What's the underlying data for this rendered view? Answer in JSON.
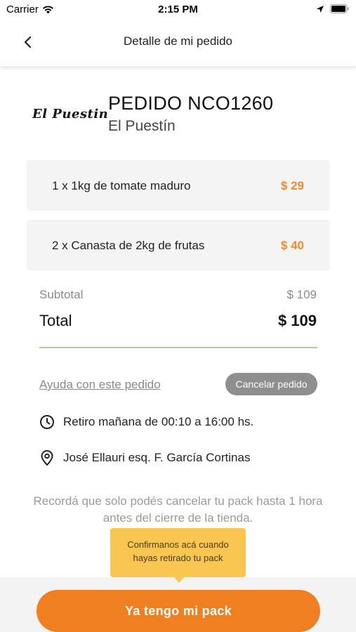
{
  "status_bar": {
    "carrier": "Carrier",
    "time": "2:15 PM"
  },
  "header": {
    "title": "Detalle de mi pedido"
  },
  "store": {
    "logo_text": "El Puestin",
    "order_title": "PEDIDO NCO1260",
    "name": "El Puestín"
  },
  "items": [
    {
      "description": "1 x 1kg de tomate maduro",
      "price": "$ 29"
    },
    {
      "description": "2 x Canasta de 2kg de frutas",
      "price": "$ 40"
    }
  ],
  "summary": {
    "subtotal_label": "Subtotal",
    "subtotal_value": "$ 109",
    "total_label": "Total",
    "total_value": "$ 109"
  },
  "actions": {
    "help_link": "Ayuda con este pedido",
    "cancel_button": "Cancelar pedido",
    "primary_button": "Ya tengo mi pack"
  },
  "pickup": {
    "time_text": "Retiro mañana de 00:10 a 16:00 hs.",
    "address_text": "José Ellauri esq. F. García Cortinas"
  },
  "note": "Recordá que solo podés cancelar tu pack hasta 1 hora antes del cierre de la tienda.",
  "tooltip": {
    "line1": "Confirmanos acá cuando",
    "line2": "hayas retirado tu pack"
  },
  "colors": {
    "accent": "#f07f22",
    "price": "#f08a2c",
    "tooltip_bg": "#f9c74f",
    "divider": "#a9d08e",
    "cancel_bg": "#8e8e8e"
  },
  "icons": {
    "wifi": "wifi-icon",
    "location_arrow": "location-arrow-icon",
    "battery": "battery-icon",
    "back": "chevron-left-icon",
    "clock": "clock-icon",
    "pin": "map-pin-icon"
  }
}
